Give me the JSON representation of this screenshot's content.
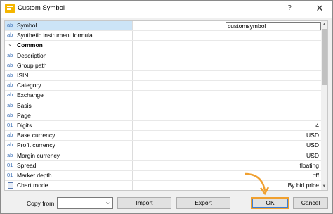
{
  "window": {
    "title": "Custom Symbol",
    "help": "?",
    "close": "✕"
  },
  "grid": {
    "rows": [
      {
        "type": "ab",
        "label": "Symbol",
        "value": "customsymbol",
        "kind": "input"
      },
      {
        "type": "ab",
        "label": "Synthetic instrument formula",
        "value": ""
      },
      {
        "type": "",
        "label": "Common",
        "value": "",
        "kind": "section"
      },
      {
        "type": "ab",
        "label": "Description",
        "value": ""
      },
      {
        "type": "ab",
        "label": "Group path",
        "value": ""
      },
      {
        "type": "ab",
        "label": "ISIN",
        "value": ""
      },
      {
        "type": "ab",
        "label": "Category",
        "value": ""
      },
      {
        "type": "ab",
        "label": "Exchange",
        "value": ""
      },
      {
        "type": "ab",
        "label": "Basis",
        "value": ""
      },
      {
        "type": "ab",
        "label": "Page",
        "value": ""
      },
      {
        "type": "01",
        "label": "Digits",
        "value": "4"
      },
      {
        "type": "ab",
        "label": "Base currency",
        "value": "USD"
      },
      {
        "type": "ab",
        "label": "Profit currency",
        "value": "USD"
      },
      {
        "type": "ab",
        "label": "Margin currency",
        "value": "USD"
      },
      {
        "type": "01",
        "label": "Spread",
        "value": "floating"
      },
      {
        "type": "01",
        "label": "Market depth",
        "value": "off"
      },
      {
        "type": "chart",
        "label": "Chart mode",
        "value": "By bid price"
      }
    ]
  },
  "bottom": {
    "copy_from_label": "Copy from:",
    "copy_from_value": "",
    "import_label": "Import",
    "export_label": "Export",
    "ok_label": "OK",
    "cancel_label": "Cancel"
  },
  "colors": {
    "accent_highlight": "#f0a030",
    "selected_row": "#cce4f7",
    "type_icon": "#3b6fb6"
  }
}
